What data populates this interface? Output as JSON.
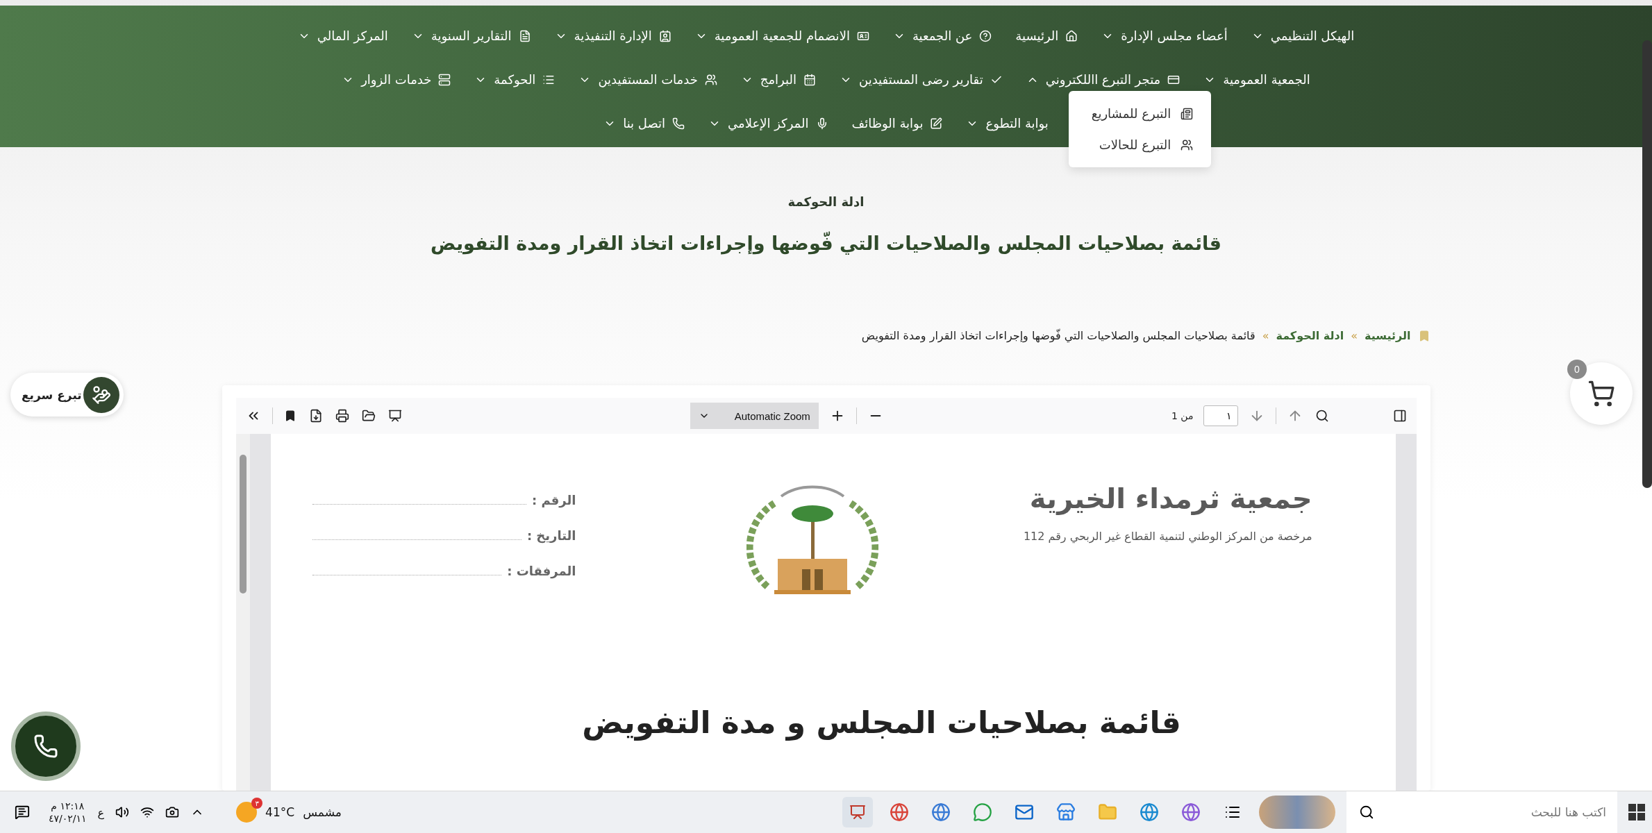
{
  "nav": {
    "items": [
      {
        "label": "الهيكل التنظيمي",
        "dropdown": true,
        "expanded": false
      },
      {
        "label": "أعضاء مجلس الإدارة",
        "dropdown": true,
        "expanded": false
      },
      {
        "label": "الرئيسية",
        "dropdown": false,
        "expanded": false
      },
      {
        "label": "عن الجمعية",
        "dropdown": true,
        "expanded": false
      },
      {
        "label": "الانضمام للجمعية العمومية",
        "dropdown": true,
        "expanded": false
      },
      {
        "label": "الإدارة التنفيذية",
        "dropdown": true,
        "expanded": false
      },
      {
        "label": "التقارير السنوية",
        "dropdown": true,
        "expanded": false
      },
      {
        "label": "المركز المالي",
        "dropdown": true,
        "expanded": false
      },
      {
        "label": "الجمعية العمومية",
        "dropdown": true,
        "expanded": false
      },
      {
        "label": "متجر التبرع االلكتروني",
        "dropdown": true,
        "expanded": true
      },
      {
        "label": "تقارير رضى المستفيدين",
        "dropdown": true,
        "expanded": false
      },
      {
        "label": "البرامج",
        "dropdown": true,
        "expanded": false
      },
      {
        "label": "خدمات المستفيدين",
        "dropdown": true,
        "expanded": false
      },
      {
        "label": "الحوكمة",
        "dropdown": true,
        "expanded": false
      },
      {
        "label": "خدمات الزوار",
        "dropdown": true,
        "expanded": false
      },
      {
        "label": "بوابة التطوع",
        "dropdown": true,
        "expanded": false
      },
      {
        "label": "بوابة الوظائف",
        "dropdown": false,
        "expanded": false
      },
      {
        "label": "المركز الإعلامي",
        "dropdown": true,
        "expanded": false
      },
      {
        "label": "اتصل بنا",
        "dropdown": true,
        "expanded": false
      }
    ]
  },
  "dropdown": {
    "items": [
      {
        "label": "التبرع للمشاريع"
      },
      {
        "label": "التبرع للحالات"
      }
    ]
  },
  "hero": {
    "kicker": "ادلة الحوكمة",
    "title": "قائمة بصلاحيات المجلس والصلاحيات التي فّوضها وإجراءات اتخاذ القرار ومدة التفويض"
  },
  "breadcrumb": {
    "separator": "»",
    "items": [
      {
        "label": "الرئيسية",
        "current": false
      },
      {
        "label": "ادلة الحوكمة",
        "current": false
      },
      {
        "label": "قائمة بصلاحيات المجلس والصلاحيات التي فّوضها وإجراءات اتخاذ القرار ومدة التفويض",
        "current": true
      }
    ]
  },
  "quick_donate": {
    "label": "تبرع سريع"
  },
  "cart": {
    "count": "0"
  },
  "pdf_viewer": {
    "toolbar": {
      "page_input": "١",
      "page_total": "من 1",
      "zoom": "Automatic Zoom"
    },
    "document": {
      "org_name": "جمعية ثرمداء الخيرية",
      "license": "مرخصة من المركز الوطني لتنمية القطاع غير الربحي رقم 112",
      "fields": [
        "الرقم :",
        "التاريخ :",
        "المرفقات :"
      ],
      "heading": "قائمة بصلاحيات المجلس و مدة التفويض"
    }
  },
  "taskbar": {
    "search_placeholder": "اكتب هنا للبحث",
    "weather": {
      "temp": "41°C",
      "condition": "مشمس",
      "badge": "٣"
    },
    "language": "ع",
    "time": "١٢:١٨ م",
    "date": "٤٧/٠٢/١١"
  }
}
